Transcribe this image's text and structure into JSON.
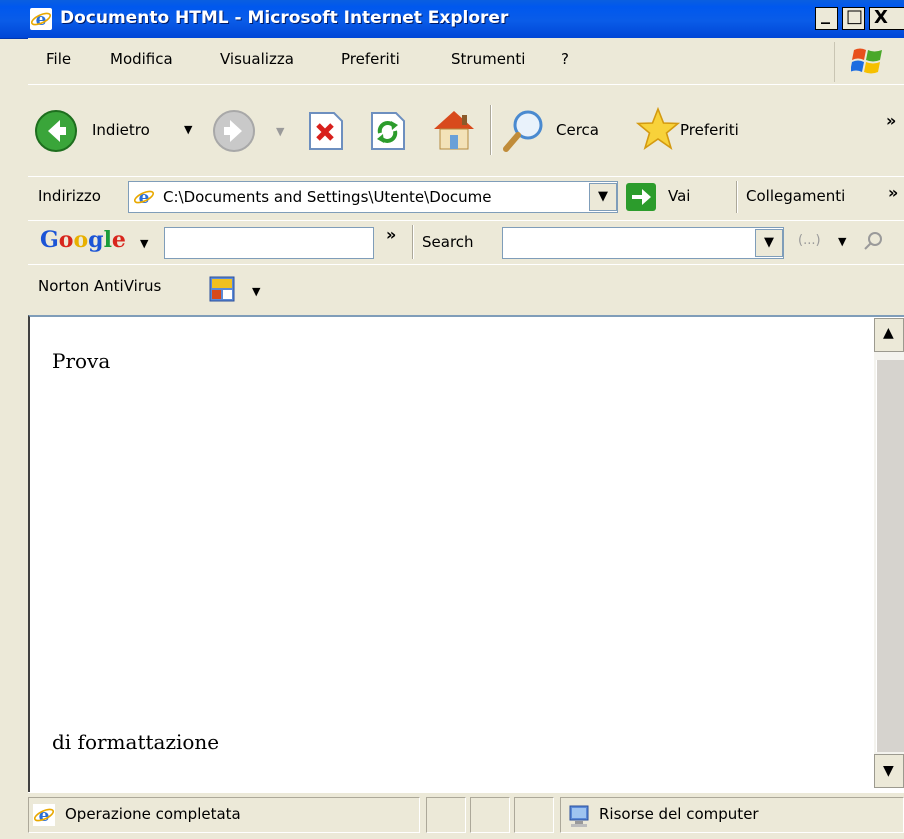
{
  "window": {
    "title": "Documento HTML - Microsoft Internet Explorer",
    "min_symbol": "_",
    "max_symbol": "□",
    "close_symbol": "X"
  },
  "menu": [
    "File",
    "Modifica",
    "Visualizza",
    "Preferiti",
    "Strumenti",
    "?"
  ],
  "nav_toolbar": {
    "back_label": "Indietro",
    "search_label": "Cerca",
    "favorites_label": "Preferiti",
    "overflow": "»"
  },
  "address_bar": {
    "label": "Indirizzo",
    "value": "C:\\Documents and Settings\\Utente\\Docume",
    "go_label": "Vai",
    "links_label": "Collegamenti",
    "overflow": "»"
  },
  "google_toolbar": {
    "logo": "Google",
    "search_label": "Search",
    "overflow": "»",
    "more_symbol": "(...)"
  },
  "norton_toolbar": {
    "label": "Norton AntiVirus"
  },
  "page": {
    "heading": "Prova",
    "paragraph": "di formattazione"
  },
  "status_bar": {
    "status_text": "Operazione completata",
    "zone_text": "Risorse del computer"
  },
  "colors": {
    "titlebar": "#0058ee",
    "face": "#ece9d8",
    "google_blue": "#1b54d6",
    "google_red": "#d8261d",
    "google_yellow": "#e8b000",
    "google_green": "#1a9c3a"
  }
}
